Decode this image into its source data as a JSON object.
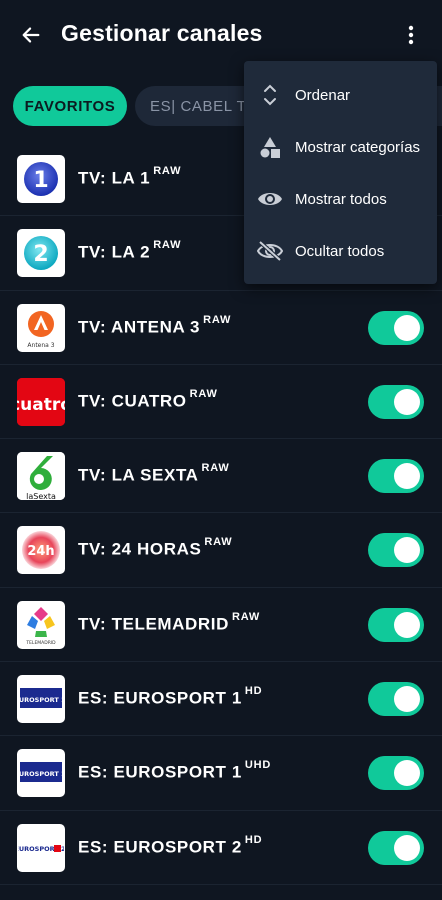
{
  "header": {
    "title": "Gestionar canales",
    "back_icon": "arrow-left-icon",
    "more_icon": "more-vertical-icon"
  },
  "chips": [
    {
      "label": "FAVORITOS",
      "active": true
    },
    {
      "label": "ES| CABEL TV",
      "active": false
    }
  ],
  "menu": {
    "items": [
      {
        "label": "Ordenar",
        "icon": "sort-icon"
      },
      {
        "label": "Mostrar categorías",
        "icon": "shapes-icon"
      },
      {
        "label": "Mostrar todos",
        "icon": "eye-icon"
      },
      {
        "label": "Ocultar todos",
        "icon": "eye-off-icon"
      }
    ]
  },
  "channels": [
    {
      "name": "TV: LA 1",
      "badge": "RAW",
      "enabled": true,
      "logo": "la1-logo"
    },
    {
      "name": "TV: LA 2",
      "badge": "RAW",
      "enabled": true,
      "logo": "la2-logo"
    },
    {
      "name": "TV: ANTENA 3",
      "badge": "RAW",
      "enabled": true,
      "logo": "antena3-logo",
      "logo_text": "Antena 3"
    },
    {
      "name": "TV: CUATRO",
      "badge": "RAW",
      "enabled": true,
      "logo": "cuatro-logo",
      "logo_text": "cuatro"
    },
    {
      "name": "TV: LA SEXTA",
      "badge": "RAW",
      "enabled": true,
      "logo": "lasexta-logo",
      "logo_text": "laSexta"
    },
    {
      "name": "TV: 24 HORAS",
      "badge": "RAW",
      "enabled": true,
      "logo": "24horas-logo",
      "logo_text": "24h"
    },
    {
      "name": "TV: TELEMADRID",
      "badge": "RAW",
      "enabled": true,
      "logo": "telemadrid-logo",
      "logo_text": "TELEMADRID"
    },
    {
      "name": "ES: EUROSPORT 1",
      "badge": "HD",
      "enabled": true,
      "logo": "eurosport1-logo",
      "logo_text": "EUROSPORT 1"
    },
    {
      "name": "ES: EUROSPORT 1",
      "badge": "UHD",
      "enabled": true,
      "logo": "eurosport1-logo",
      "logo_text": "EUROSPORT 1"
    },
    {
      "name": "ES: EUROSPORT 2",
      "badge": "HD",
      "enabled": true,
      "logo": "eurosport2-logo",
      "logo_text": "EUROSPORT 2"
    }
  ],
  "colors": {
    "background": "#0f1621",
    "accent": "#10c99a",
    "menu_background": "#1f2a3a",
    "chip_inactive": "#1e2838"
  }
}
